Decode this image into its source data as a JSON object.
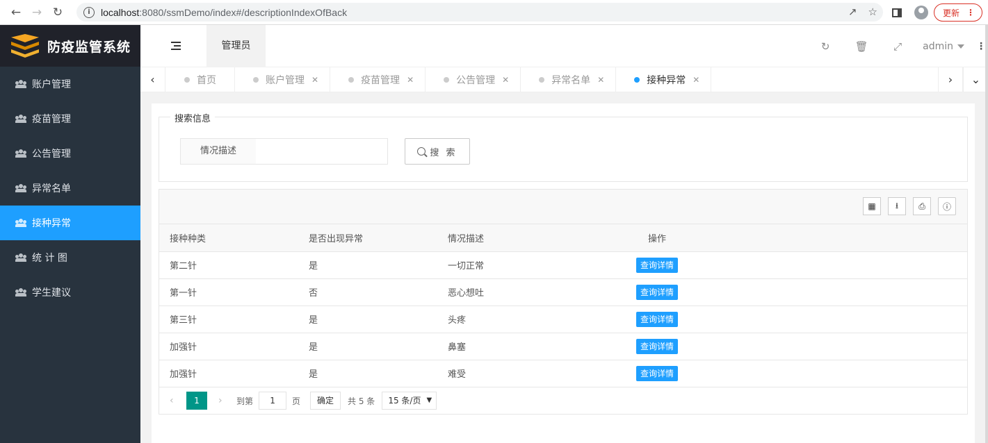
{
  "browser": {
    "url_host": "localhost",
    "url_rest": ":8080/ssmDemo/index#/descriptionIndexOfBack",
    "update_label": "更新"
  },
  "sidebar": {
    "brand": "防疫监管系统",
    "items": [
      {
        "label": "账户管理"
      },
      {
        "label": "疫苗管理"
      },
      {
        "label": "公告管理"
      },
      {
        "label": "异常名单"
      },
      {
        "label": "接种异常"
      },
      {
        "label": "统 计 图"
      },
      {
        "label": "学生建议"
      }
    ]
  },
  "header": {
    "role": "管理员",
    "user": "admin"
  },
  "tabs": [
    {
      "label": "首页"
    },
    {
      "label": "账户管理"
    },
    {
      "label": "疫苗管理"
    },
    {
      "label": "公告管理"
    },
    {
      "label": "异常名单"
    },
    {
      "label": "接种异常"
    }
  ],
  "search": {
    "legend": "搜索信息",
    "field_label": "情况描述",
    "value": "",
    "button": "搜 索"
  },
  "table": {
    "columns": [
      "接种种类",
      "是否出现异常",
      "情况描述",
      "操作"
    ],
    "rows": [
      {
        "kind": "第二针",
        "abnormal": "是",
        "desc": "一切正常",
        "action": "查询详情"
      },
      {
        "kind": "第一针",
        "abnormal": "否",
        "desc": "恶心想吐",
        "action": "查询详情"
      },
      {
        "kind": "第三针",
        "abnormal": "是",
        "desc": "头疼",
        "action": "查询详情"
      },
      {
        "kind": "加强针",
        "abnormal": "是",
        "desc": "鼻塞",
        "action": "查询详情"
      },
      {
        "kind": "加强针",
        "abnormal": "是",
        "desc": "难受",
        "action": "查询详情"
      }
    ]
  },
  "pager": {
    "current": "1",
    "goto_prefix": "到第",
    "goto_value": "1",
    "goto_suffix": "页",
    "confirm": "确定",
    "total": "共 5 条",
    "page_size": "15 条/页"
  },
  "colors": {
    "accent": "#1e9fff",
    "sidebar": "#28333e",
    "brand_bg": "#20222a",
    "pager_active": "#009688"
  }
}
